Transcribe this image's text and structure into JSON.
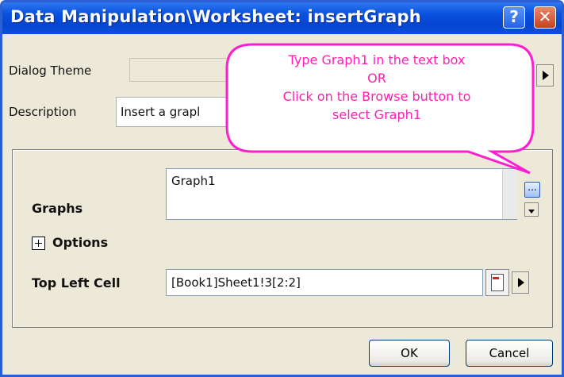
{
  "window": {
    "title": "Data Manipulation\\Worksheet: insertGraph"
  },
  "titlebar": {
    "help_glyph": "?",
    "close_glyph": "✕"
  },
  "dialog_theme": {
    "label": "Dialog Theme"
  },
  "description": {
    "label": "Description",
    "value": "Insert a grapl"
  },
  "callout": {
    "line1": "Type Graph1 in the text box",
    "line2": "OR",
    "line3": "Click on the Browse button to",
    "line4": "select Graph1",
    "fill": "#ffffff",
    "border": "#ff1fd0",
    "text_color": "#ff1fb2"
  },
  "graphs": {
    "label": "Graphs",
    "value": "Graph1",
    "browse_glyph": "..."
  },
  "options": {
    "label": "Options",
    "toggle_glyph": "⊞"
  },
  "top_left_cell": {
    "label": "Top Left Cell",
    "value": "[Book1]Sheet1!3[2:2]"
  },
  "buttons": {
    "ok": "OK",
    "cancel": "Cancel"
  },
  "colors": {
    "titlebar": "#0a53e0",
    "dialog_bg": "#ece9d8",
    "accent": "#2a5fd6"
  }
}
